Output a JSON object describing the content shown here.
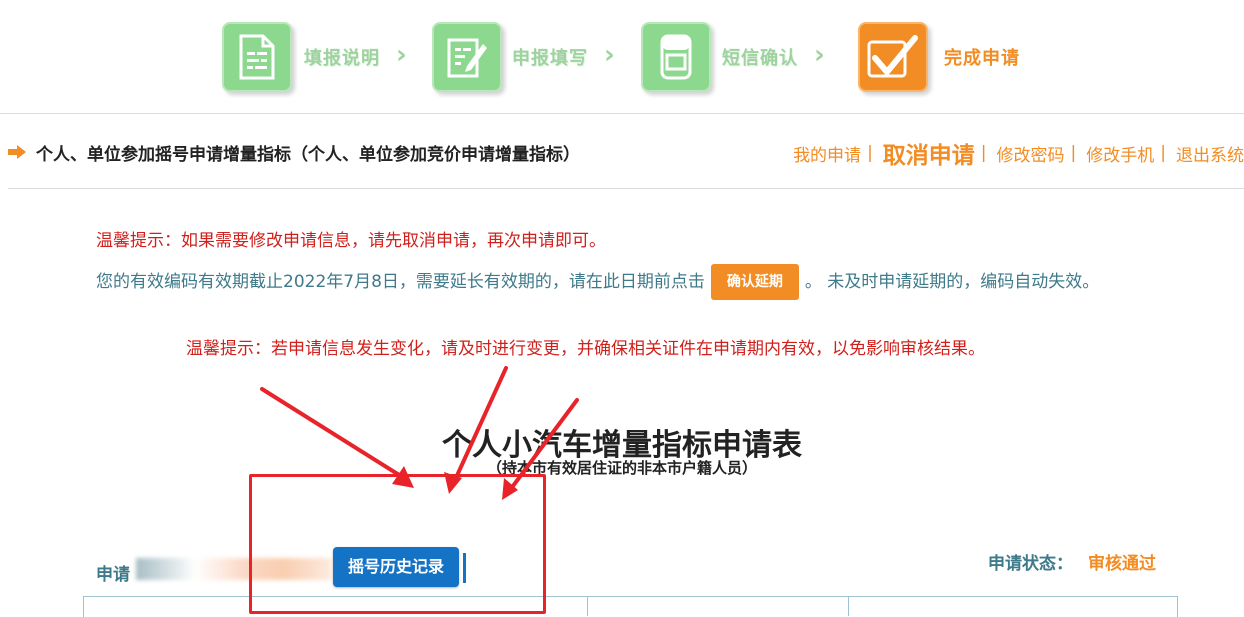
{
  "steps": [
    {
      "label": "填报说明",
      "icon": "document-icon",
      "state": "done"
    },
    {
      "label": "申报填写",
      "icon": "form-edit-icon",
      "state": "done"
    },
    {
      "label": "短信确认",
      "icon": "phone-icon",
      "state": "done"
    },
    {
      "label": "完成申请",
      "icon": "checkmark-icon",
      "state": "current"
    }
  ],
  "header": {
    "title": "个人、单位参加摇号申请增量指标（个人、单位参加竞价申请增量指标）",
    "links": [
      {
        "label": "我的申请",
        "emphasis": false
      },
      {
        "label": "取消申请",
        "emphasis": true
      },
      {
        "label": "修改密码",
        "emphasis": false
      },
      {
        "label": "修改手机",
        "emphasis": false
      },
      {
        "label": "退出系统",
        "emphasis": false
      }
    ],
    "separator": "|"
  },
  "notices": {
    "tip1": "温馨提示：如果需要修改申请信息，请先取消申请，再次申请即可。",
    "validity_before": "您的有效编码有效期截止2022年7月8日，需要延长有效期的，请在此日期前点击",
    "extend_button": "确认延期",
    "validity_after": "。 未及时申请延期的，编码自动失效。",
    "tip2": "温馨提示：若申请信息发生变化，请及时进行变更，并确保相关证件在申请期内有效，以免影响审核结果。"
  },
  "form": {
    "title": "个人小汽车增量指标申请表",
    "subtitle": "（持本市有效居住证的非本市户籍人员）",
    "applicant_label": "申请",
    "history_button": "摇号历史记录",
    "status_label": "申请状态：",
    "status_value": "审核通过"
  },
  "colors": {
    "accent_orange": "#f28c24",
    "step_green": "#8dd88f",
    "notice_red": "#d0201c",
    "notice_teal": "#3e7a8a",
    "button_blue": "#1573c5",
    "annotation_red": "#e8232a"
  }
}
